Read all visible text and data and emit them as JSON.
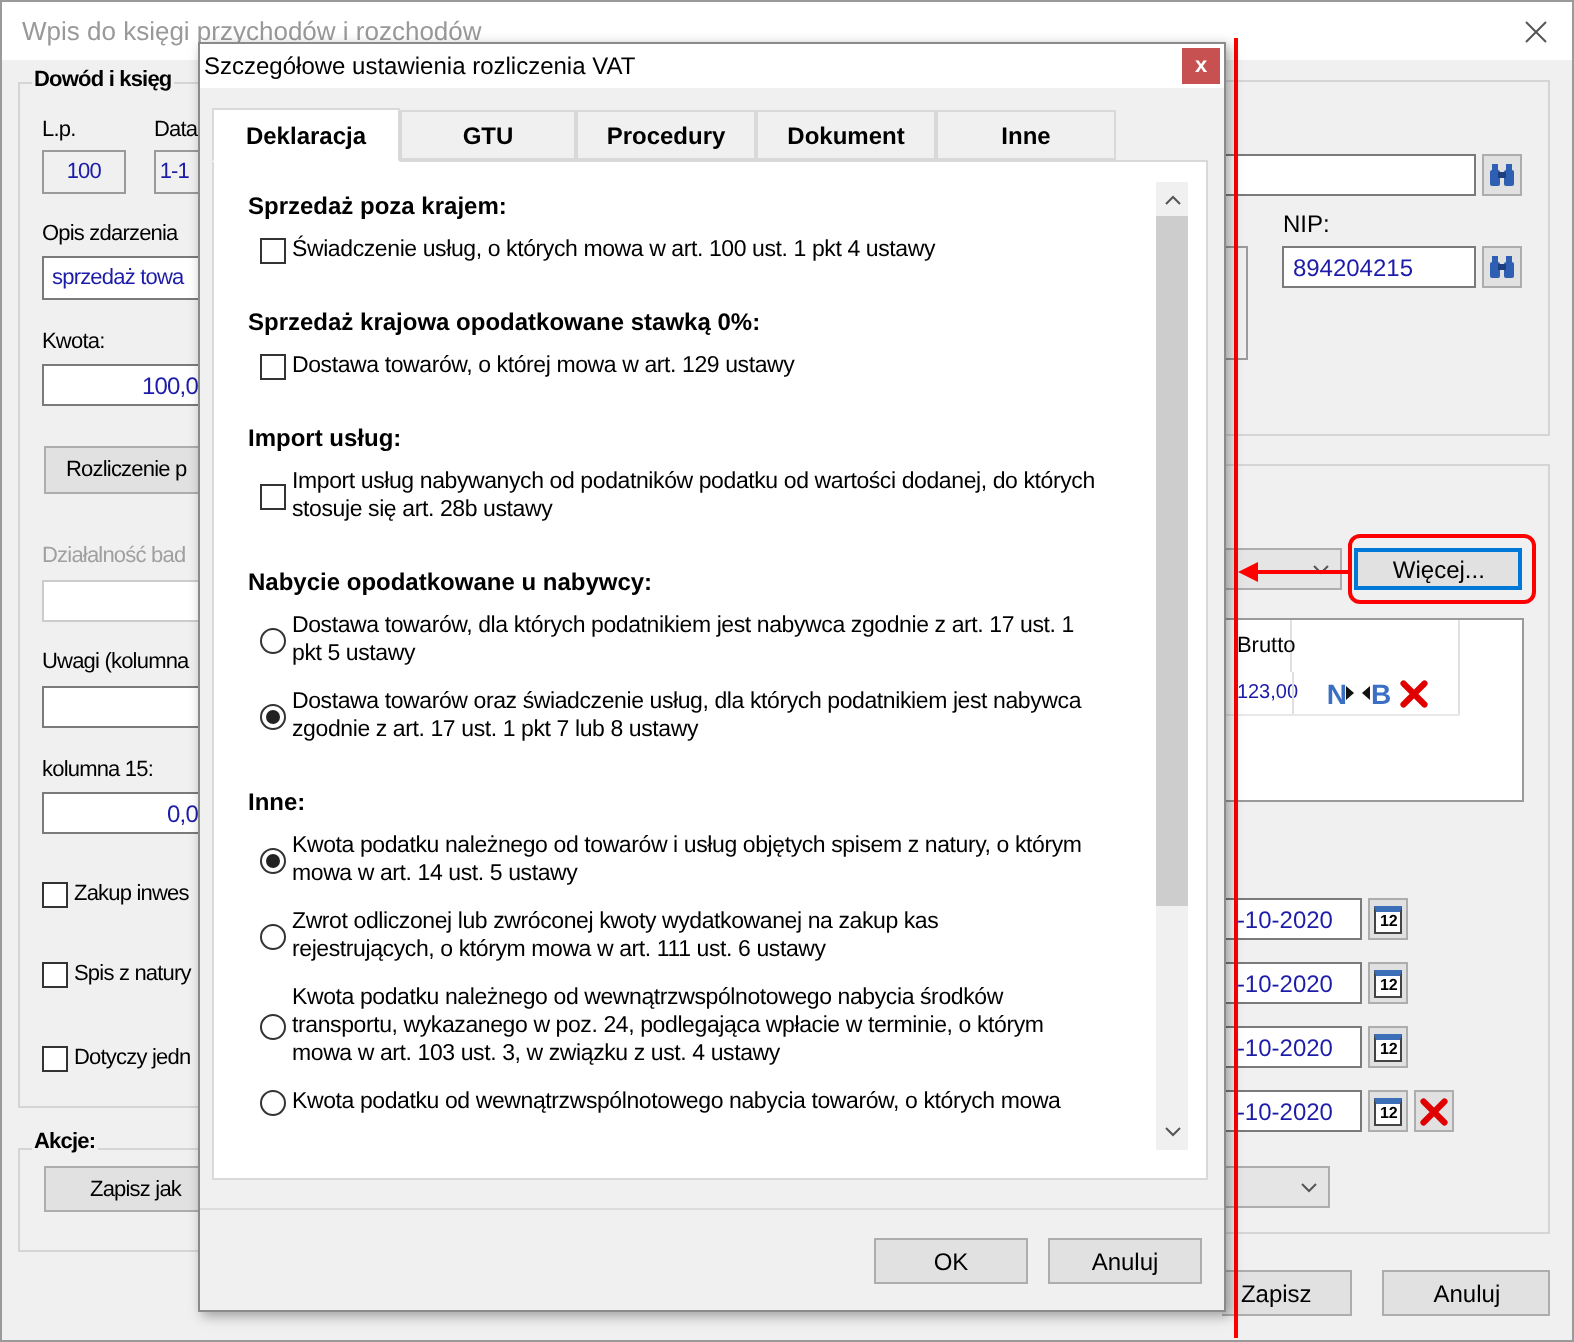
{
  "window": {
    "title": "Wpis do księgi przychodów i rozchodów"
  },
  "form": {
    "group_title": "Dowód i księg",
    "lp_label": "L.p.",
    "lp_value": "100",
    "date_label": "Data",
    "date_value": "1-1",
    "description_label": "Opis zdarzenia",
    "description_value": "sprzedaż towa",
    "amount_label": "Kwota:",
    "amount_value": "100,0",
    "settlement_button": "Rozliczenie p",
    "activity": {
      "label": "Działalność bad",
      "disabled": true
    },
    "notes_label": "Uwagi (kolumna",
    "column15_label": "kolumna 15:",
    "column15_value": "0,0",
    "checkboxes": [
      {
        "label": "Zakup inwes",
        "checked": false
      },
      {
        "label": "Spis z natury",
        "checked": false
      },
      {
        "label": "Dotyczy jedn",
        "checked": false
      }
    ],
    "actions_title": "Akcje:",
    "save_as_button": "Zapisz jak",
    "nip_label": "NIP:",
    "nip_value": "894204215",
    "more_button": "Więcej...",
    "table": {
      "columns": [
        "Brutto"
      ],
      "rows": [
        {
          "gross": "123,00",
          "actions": [
            {
              "kind": "next",
              "label": "N"
            },
            {
              "kind": "back",
              "label": "B"
            }
          ]
        }
      ]
    },
    "dates": [
      {
        "value": "-10-2020",
        "calendar": "12",
        "clearable": false
      },
      {
        "value": "-10-2020",
        "calendar": "12",
        "clearable": false
      },
      {
        "value": "-10-2020",
        "calendar": "12",
        "clearable": false
      },
      {
        "value": "-10-2020",
        "calendar": "12",
        "clearable": true
      }
    ],
    "buttons": [
      "Zapisz",
      "Anuluj"
    ]
  },
  "dialog": {
    "title": "Szczegółowe ustawienia rozliczenia VAT",
    "close": "x",
    "tabs": [
      {
        "label": "Deklaracja",
        "selected": true
      },
      {
        "label": "GTU",
        "selected": false
      },
      {
        "label": "Procedury",
        "selected": false
      },
      {
        "label": "Dokument",
        "selected": false
      },
      {
        "label": "Inne",
        "selected": false
      }
    ],
    "sections": [
      {
        "heading": "Sprzedaż poza krajem:",
        "options": [
          {
            "kind": "checkbox",
            "label": "Świadczenie usług, o których mowa w art. 100 ust. 1 pkt 4 ustawy",
            "checked": false
          }
        ]
      },
      {
        "heading": "Sprzedaż krajowa opodatkowane stawką 0%:",
        "options": [
          {
            "kind": "checkbox",
            "label": "Dostawa towarów, o której mowa w art. 129 ustawy",
            "checked": false
          }
        ]
      },
      {
        "heading": "Import usług:",
        "options": [
          {
            "kind": "checkbox",
            "label": "Import usług nabywanych od podatników podatku od wartości dodanej, do których\nstosuje się art. 28b ustawy",
            "checked": false
          }
        ]
      },
      {
        "heading": "Nabycie opodatkowane u nabywcy:",
        "options": [
          {
            "kind": "radio",
            "label": "Dostawa towarów, dla których podatnikiem jest nabywca zgodnie z art. 17 ust. 1\npkt 5 ustawy",
            "selected": false
          },
          {
            "kind": "radio",
            "label": "Dostawa towarów oraz świadczenie usług, dla których podatnikiem jest nabywca\nzgodnie z art. 17 ust. 1 pkt 7 lub 8 ustawy",
            "selected": true
          }
        ]
      },
      {
        "heading": "Inne:",
        "options": [
          {
            "kind": "radio",
            "label": "Kwota podatku należnego od towarów i usług objętych spisem z natury, o którym\nmowa w art. 14 ust. 5 ustawy",
            "selected": true
          },
          {
            "kind": "radio",
            "label": "Zwrot odliczonej lub zwróconej kwoty wydatkowanej na zakup kas\nrejestrujących, o którym mowa w art. 111 ust. 6 ustawy",
            "selected": false
          },
          {
            "kind": "radio",
            "label": "Kwota podatku należnego od wewnątrzwspólnotowego nabycia środków\ntransportu, wykazanego w poz. 24, podlegająca wpłacie w terminie, o którym\nmowa w art. 103 ust. 3, w związku z ust. 4 ustawy",
            "selected": false
          },
          {
            "kind": "radio",
            "label": "Kwota podatku od wewnątrzwspólnotowego nabycia towarów, o których mowa",
            "selected": false
          }
        ]
      }
    ],
    "buttons": [
      "OK",
      "Anuluj"
    ]
  }
}
